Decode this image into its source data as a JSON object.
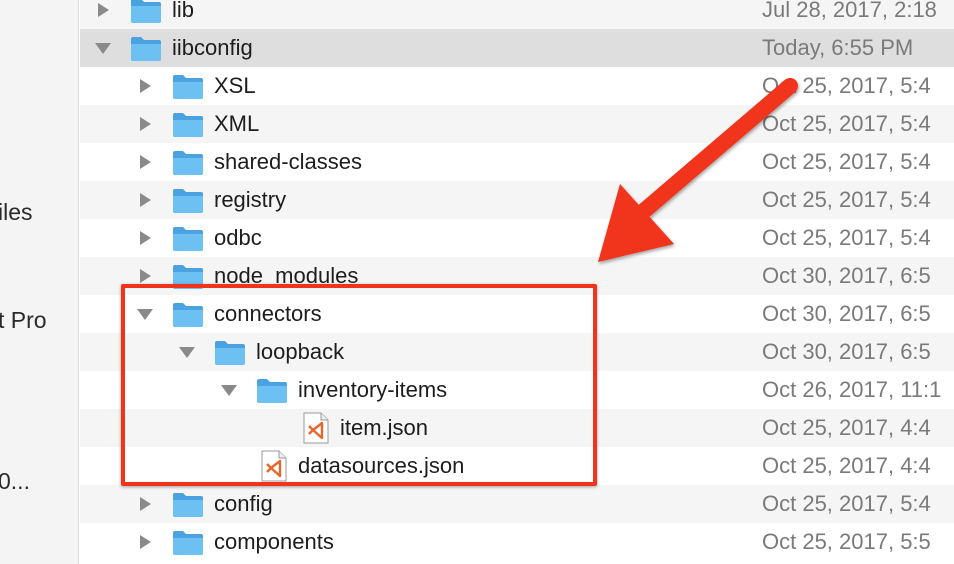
{
  "sidebar": {
    "items": [
      {
        "label": "iles"
      },
      {
        "label": "t Pro"
      },
      {
        "label": "0..."
      }
    ]
  },
  "rows": [
    {
      "name": "lib",
      "date": "Jul 28, 2017, 2:18",
      "type": "folder",
      "expanded": false
    },
    {
      "name": "iibconfig",
      "date": "Today, 6:55 PM",
      "type": "folder",
      "expanded": true
    },
    {
      "name": "XSL",
      "date": "Oct 25, 2017, 5:4",
      "type": "folder",
      "expanded": false
    },
    {
      "name": "XML",
      "date": "Oct 25, 2017, 5:4",
      "type": "folder",
      "expanded": false
    },
    {
      "name": "shared-classes",
      "date": "Oct 25, 2017, 5:4",
      "type": "folder",
      "expanded": false
    },
    {
      "name": "registry",
      "date": "Oct 25, 2017, 5:4",
      "type": "folder",
      "expanded": false
    },
    {
      "name": "odbc",
      "date": "Oct 25, 2017, 5:4",
      "type": "folder",
      "expanded": false
    },
    {
      "name": "node_modules",
      "date": "Oct 30, 2017, 6:5",
      "type": "folder",
      "expanded": false
    },
    {
      "name": "connectors",
      "date": "Oct 30, 2017, 6:5",
      "type": "folder",
      "expanded": true
    },
    {
      "name": "loopback",
      "date": "Oct 30, 2017, 6:5",
      "type": "folder",
      "expanded": true
    },
    {
      "name": "inventory-items",
      "date": "Oct 26, 2017, 11:1",
      "type": "folder",
      "expanded": true
    },
    {
      "name": "item.json",
      "date": "Oct 25, 2017, 4:4",
      "type": "file"
    },
    {
      "name": "datasources.json",
      "date": "Oct 25, 2017, 4:4",
      "type": "file"
    },
    {
      "name": "config",
      "date": "Oct 25, 2017, 5:4",
      "type": "folder",
      "expanded": false
    },
    {
      "name": "components",
      "date": "Oct 25, 2017, 5:5",
      "type": "folder",
      "expanded": false
    }
  ],
  "colors": {
    "annotation": "#f0341c",
    "folder": "#6cc0f2",
    "vscode_file_accent": "#e8662a"
  },
  "icons": {
    "folder": "folder-icon",
    "file": "vscode-json-file-icon",
    "collapsed": "disclosure-triangle-right-icon",
    "expanded": "disclosure-triangle-down-icon"
  }
}
